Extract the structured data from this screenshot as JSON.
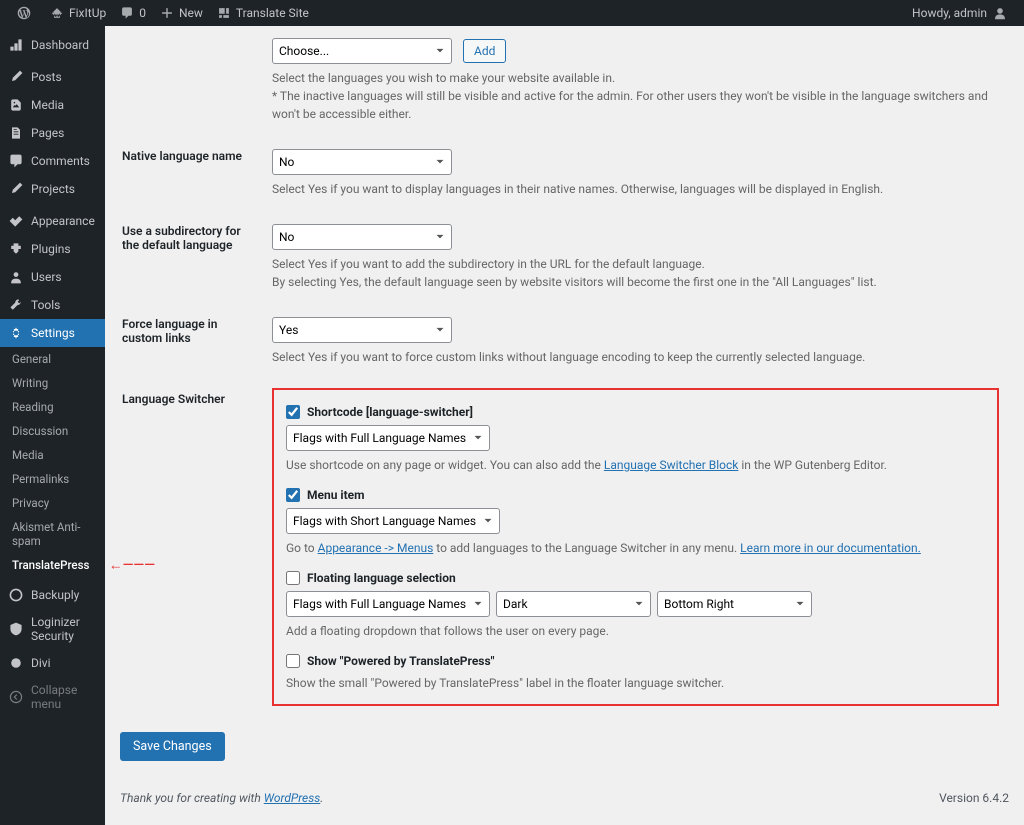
{
  "adminbar": {
    "site_name": "FixItUp",
    "comment_count": "0",
    "new_label": "New",
    "translate_label": "Translate Site",
    "howdy": "Howdy, admin"
  },
  "menu": {
    "dashboard": "Dashboard",
    "posts": "Posts",
    "media": "Media",
    "pages": "Pages",
    "comments": "Comments",
    "projects": "Projects",
    "appearance": "Appearance",
    "plugins": "Plugins",
    "users": "Users",
    "tools": "Tools",
    "settings": "Settings",
    "sub": {
      "general": "General",
      "writing": "Writing",
      "reading": "Reading",
      "discussion": "Discussion",
      "media": "Media",
      "permalinks": "Permalinks",
      "privacy": "Privacy",
      "akismet": "Akismet Anti-spam",
      "translatepress": "TranslatePress"
    },
    "backuply": "Backuply",
    "loginizer": "Loginizer Security",
    "divi": "Divi",
    "collapse": "Collapse menu"
  },
  "form": {
    "all_lang": {
      "choose": "Choose...",
      "add": "Add",
      "desc1": "Select the languages you wish to make your website available in.",
      "desc2": "* The inactive languages will still be visible and active for the admin. For other users they won't be visible in the language switchers and won't be accessible either."
    },
    "native": {
      "label": "Native language name",
      "value": "No",
      "desc": "Select Yes if you want to display languages in their native names. Otherwise, languages will be displayed in English."
    },
    "subdir": {
      "label": "Use a subdirectory for the default language",
      "value": "No",
      "desc1": "Select Yes if you want to add the subdirectory in the URL for the default language.",
      "desc2": "By selecting Yes, the default language seen by website visitors will become the first one in the \"All Languages\" list."
    },
    "force": {
      "label": "Force language in custom links",
      "value": "Yes",
      "desc": "Select Yes if you want to force custom links without language encoding to keep the currently selected language."
    },
    "switcher": {
      "label": "Language Switcher",
      "shortcode_label": "Shortcode [language-switcher]",
      "shortcode_sel": "Flags with Full Language Names",
      "shortcode_desc1": "Use shortcode on any page or widget. You can also add the ",
      "shortcode_link": "Language Switcher Block",
      "shortcode_desc2": " in the WP Gutenberg Editor.",
      "menu_label": "Menu item",
      "menu_sel": "Flags with Short Language Names",
      "menu_desc1": "Go to ",
      "menu_link1": "Appearance -> Menus",
      "menu_desc2": " to add languages to the Language Switcher in any menu. ",
      "menu_link2": "Learn more in our documentation.",
      "float_label": "Floating language selection",
      "float_sel1": "Flags with Full Language Names",
      "float_sel2": "Dark",
      "float_sel3": "Bottom Right",
      "float_desc": "Add a floating dropdown that follows the user on every page.",
      "powered_label": "Show \"Powered by TranslatePress\"",
      "powered_desc": "Show the small \"Powered by TranslatePress\" label in the floater language switcher."
    },
    "save": "Save Changes"
  },
  "footer": {
    "thanks1": "Thank you for creating with ",
    "wp": "WordPress",
    "version": "Version 6.4.2"
  }
}
